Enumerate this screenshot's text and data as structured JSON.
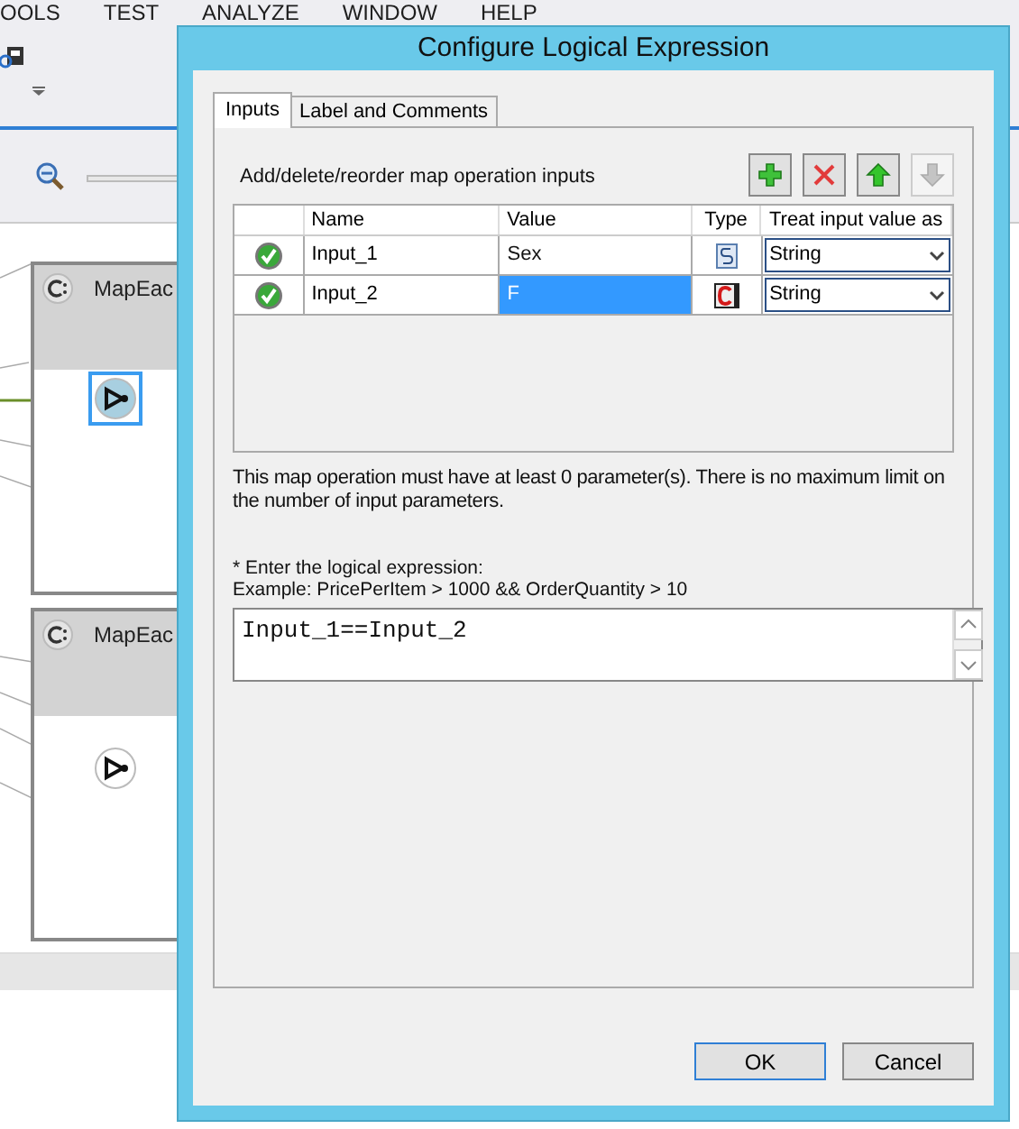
{
  "menu": [
    "OOLS",
    "TEST",
    "ANALYZE",
    "WINDOW",
    "HELP"
  ],
  "canvas": {
    "nodes": [
      {
        "title": "MapEac",
        "selected": true
      },
      {
        "title": "MapEac",
        "selected": false
      }
    ]
  },
  "dialog": {
    "title": "Configure Logical Expression",
    "tabs": [
      {
        "label": "Inputs",
        "selected": true
      },
      {
        "label": "Label and Comments",
        "selected": false
      }
    ],
    "toolbar_label": "Add/delete/reorder map operation inputs",
    "toolbar_buttons": [
      {
        "kind": "add",
        "disabled": false
      },
      {
        "kind": "delete",
        "disabled": false
      },
      {
        "kind": "up",
        "disabled": false
      },
      {
        "kind": "down",
        "disabled": true
      }
    ],
    "table": {
      "columns": [
        "Name",
        "Value",
        "Type",
        "Treat input value as"
      ],
      "rows": [
        {
          "valid": true,
          "name": "Input_1",
          "value": "Sex",
          "type": {
            "kind": "variable"
          },
          "treat_as": "String",
          "selected": false
        },
        {
          "valid": true,
          "name": "Input_2",
          "value": "F",
          "type": {
            "kind": "constant"
          },
          "treat_as": "String",
          "selected": true
        }
      ]
    },
    "note": "This map operation must have at least 0 parameter(s). There is no maximum limit on the number of input parameters.",
    "expression_label": "* Enter the logical expression:",
    "example": "Example: PricePerItem > 1000 && OrderQuantity > 10",
    "expression": "Input_1==Input_2",
    "buttons": [
      {
        "label": "OK",
        "default": true
      },
      {
        "label": "Cancel",
        "default": false
      }
    ]
  }
}
